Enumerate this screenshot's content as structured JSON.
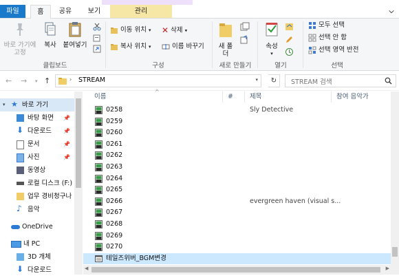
{
  "ribbon_tabs": {
    "file": "파일",
    "home": "홈",
    "share": "공유",
    "view": "보기",
    "manage": "관리"
  },
  "ribbon": {
    "pin_label": "바로 가기에 고정",
    "copy_label": "복사",
    "paste_label": "붙여넣기",
    "clipboard_group": "클립보드",
    "move_to": "이동 위치",
    "copy_to": "복사 위치",
    "delete": "삭제",
    "rename": "이름 바꾸기",
    "organize_group": "구성",
    "new_folder_label": "새 폴더",
    "new_group": "새로 만들기",
    "properties_label": "속성",
    "open_group": "열기",
    "select_all": "모두 선택",
    "select_none": "선택 안 함",
    "invert_selection": "선택 영역 반전",
    "select_group": "선택"
  },
  "address": {
    "path": "STREAM",
    "search_placeholder": "STREAM 검색"
  },
  "nav": [
    {
      "label": "바로 가기",
      "icon": "star-icon",
      "pinned": false
    },
    {
      "label": "바탕 화면",
      "icon": "desktop-icon",
      "pinned": true
    },
    {
      "label": "다운로드",
      "icon": "download-icon",
      "pinned": true
    },
    {
      "label": "문서",
      "icon": "document-icon",
      "pinned": true
    },
    {
      "label": "사진",
      "icon": "pictures-icon",
      "pinned": true
    },
    {
      "label": "동영상",
      "icon": "video-folder-icon",
      "pinned": false
    },
    {
      "label": "로컬 디스크 (F:)",
      "icon": "drive-icon",
      "pinned": false
    },
    {
      "label": "업무 경비청구나",
      "icon": "folder-icon",
      "pinned": false
    },
    {
      "label": "음악",
      "icon": "music-icon",
      "pinned": false
    },
    {
      "label": "OneDrive",
      "icon": "onedrive-icon",
      "pinned": false
    },
    {
      "label": "내 PC",
      "icon": "pc-icon",
      "pinned": false
    },
    {
      "label": "3D 개체",
      "icon": "3d-objects-icon",
      "pinned": false
    },
    {
      "label": "다운로드",
      "icon": "download-icon",
      "pinned": false
    }
  ],
  "columns": {
    "name": "이름",
    "number": "#",
    "title": "제목",
    "artist": "참여 음악가"
  },
  "files": [
    {
      "name": "0258",
      "title": "Sly Detective"
    },
    {
      "name": "0259",
      "title": ""
    },
    {
      "name": "0260",
      "title": ""
    },
    {
      "name": "0261",
      "title": ""
    },
    {
      "name": "0262",
      "title": ""
    },
    {
      "name": "0263",
      "title": ""
    },
    {
      "name": "0264",
      "title": ""
    },
    {
      "name": "0265",
      "title": ""
    },
    {
      "name": "0266",
      "title": "evergreen haven (visual s..."
    },
    {
      "name": "0267",
      "title": ""
    },
    {
      "name": "0268",
      "title": ""
    },
    {
      "name": "0269",
      "title": ""
    },
    {
      "name": "0270",
      "title": ""
    },
    {
      "name": "테일즈위버_BGM변경",
      "title": ""
    }
  ],
  "colors": {
    "file_tab": "#1979ca",
    "manage_tab": "#f7e7a6",
    "selection": "#cce8ff"
  }
}
